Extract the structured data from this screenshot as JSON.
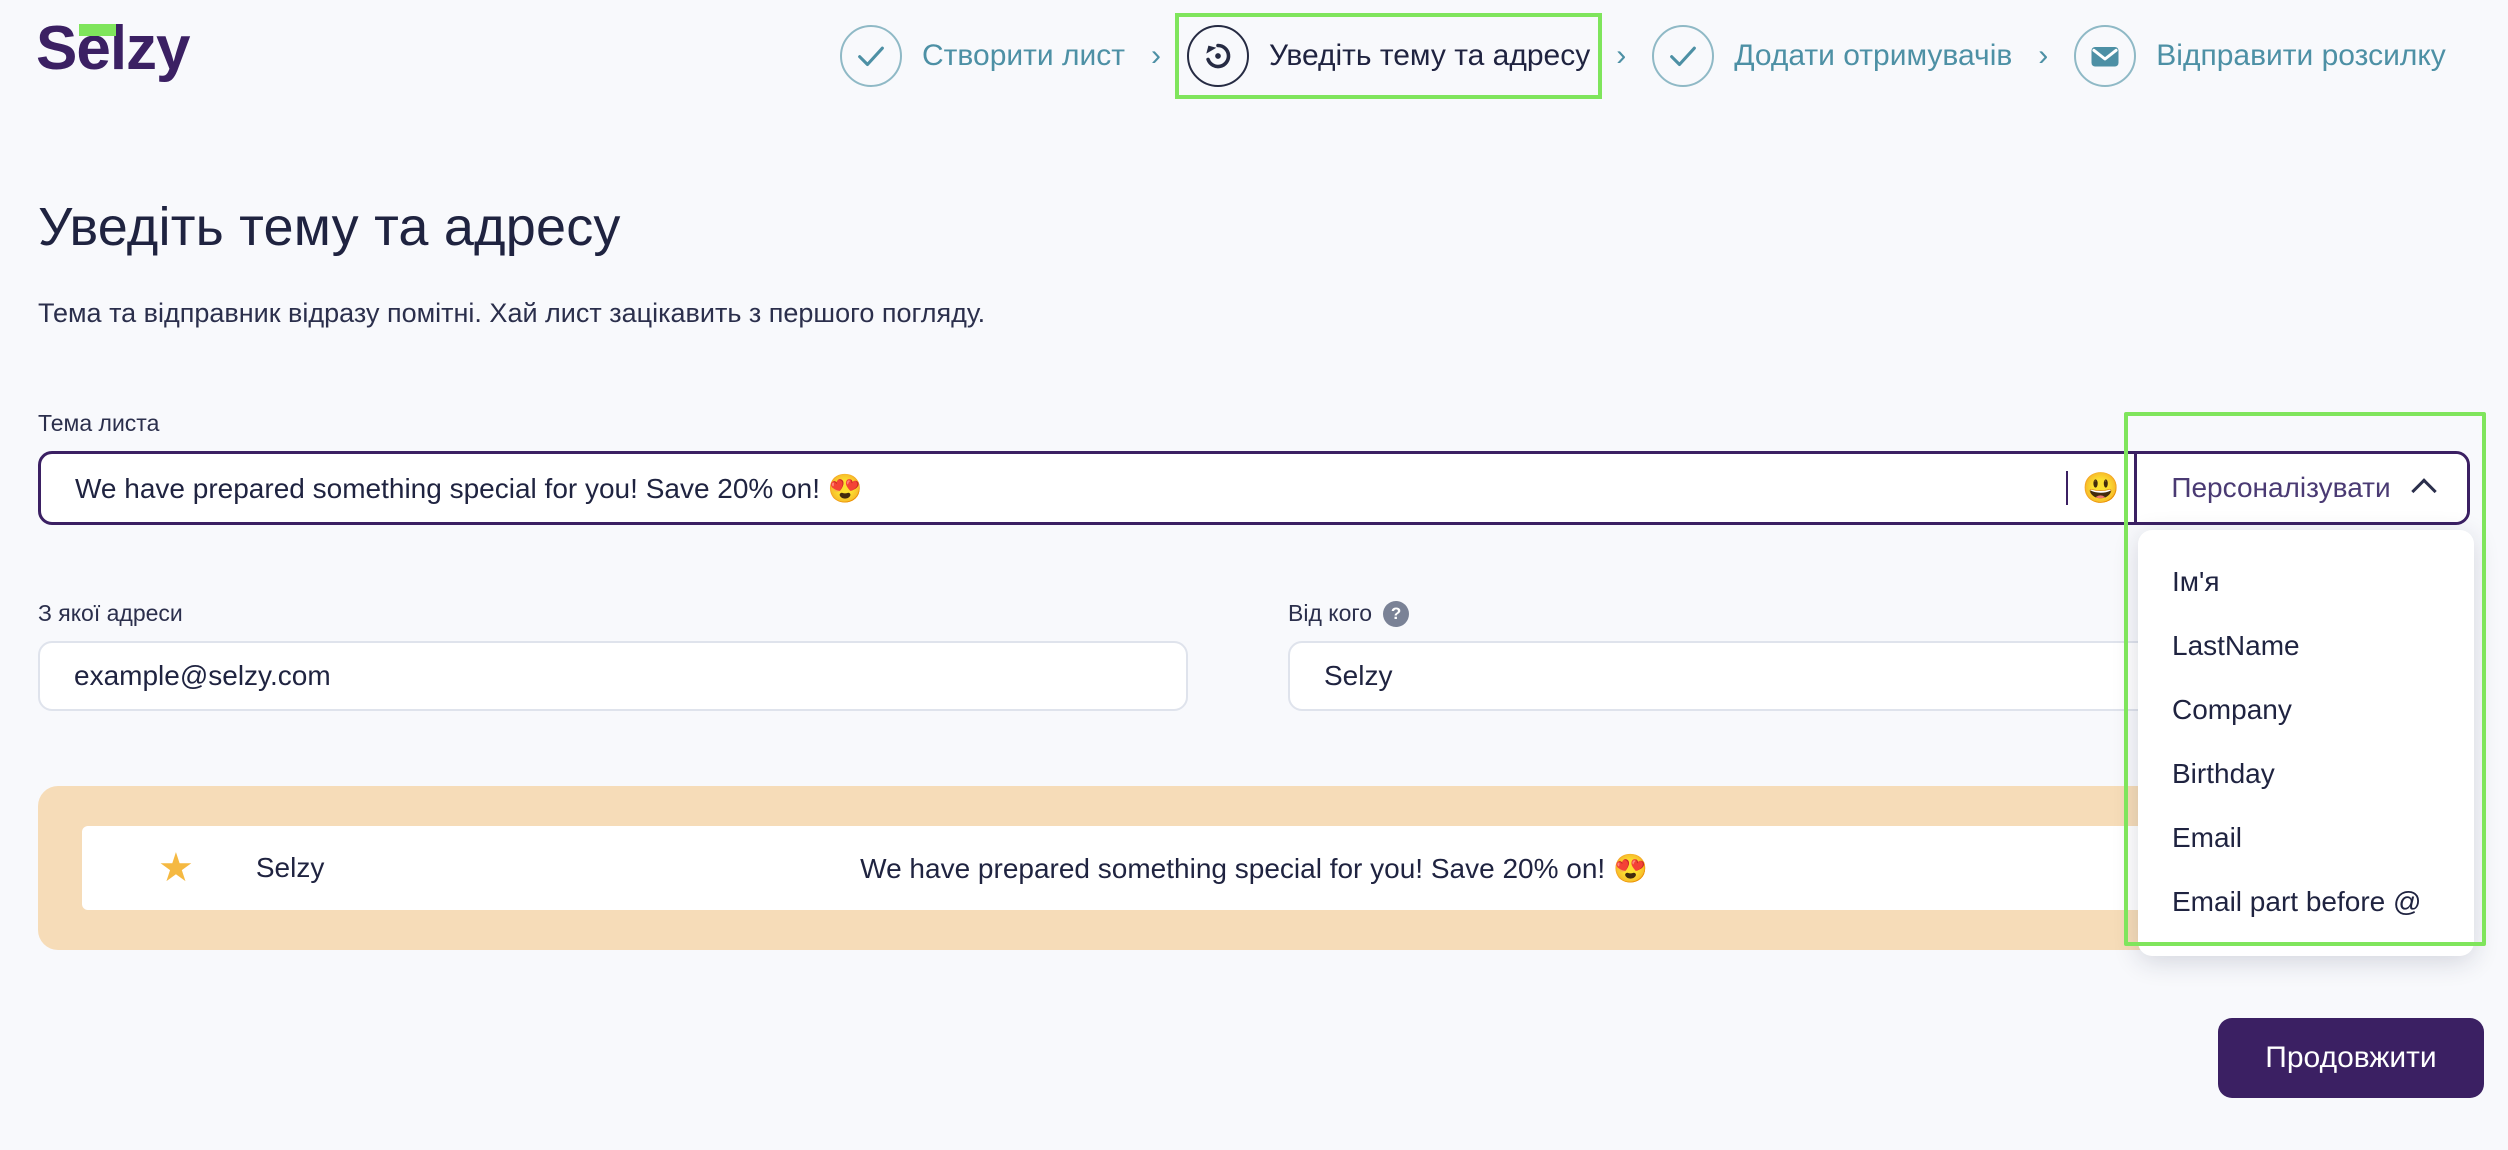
{
  "brand": {
    "logo_text": "Selzy",
    "primary_color": "#3B2063",
    "accent_green": "#7FE55C",
    "step_teal": "#4D90A5"
  },
  "stepper": {
    "separator": "›",
    "steps": [
      {
        "label": "Створити лист",
        "icon": "check-icon",
        "state": "done"
      },
      {
        "label": "Уведіть тему та адресу",
        "icon": "restore-icon",
        "state": "active"
      },
      {
        "label": "Додати отримувачів",
        "icon": "check-icon",
        "state": "done"
      },
      {
        "label": "Відправити розсилку",
        "icon": "envelope-icon",
        "state": "pending"
      }
    ]
  },
  "main": {
    "title": "Уведіть тему та адресу",
    "subtitle": "Тема та відправник відразу помітні. Хай лист зацікавить з першого погляду."
  },
  "subject": {
    "label": "Тема листа",
    "value": "We have prepared something special for you! Save 20% on! 😍",
    "placeholder": "Тема листа",
    "emoji_icon": "😃",
    "personalize_label": "Персоналізувати",
    "personalize_chevron": "chevron-up-icon"
  },
  "personalize_dropdown": {
    "expanded": true,
    "items": [
      "Ім'я",
      "LastName",
      "Company",
      "Birthday",
      "Email",
      "Email part before @"
    ]
  },
  "from_address": {
    "label": "З якої адреси",
    "value": "example@selzy.com",
    "placeholder": "example@selzy.com"
  },
  "from_name": {
    "label": "Від кого",
    "help_icon": "?",
    "value": "Selzy",
    "placeholder": "Selzy"
  },
  "preview": {
    "star_icon": "★",
    "sender": "Selzy",
    "subject": "We have prepared something special for you! Save 20% on! 😍",
    "background_color": "#F6DCB8"
  },
  "footer": {
    "continue_label": "Продовжити"
  }
}
